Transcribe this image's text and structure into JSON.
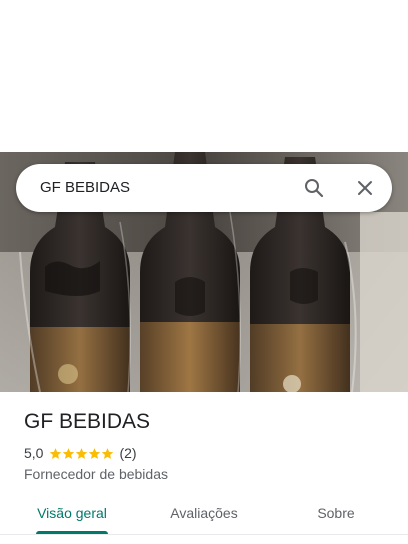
{
  "search": {
    "query": "GF BEBIDAS"
  },
  "place": {
    "name": "GF BEBIDAS",
    "rating": "5,0",
    "stars": 5,
    "review_count": "(2)",
    "category": "Fornecedor de bebidas"
  },
  "tabs": [
    {
      "label": "Visão geral",
      "selected": true
    },
    {
      "label": "Avaliações",
      "selected": false
    },
    {
      "label": "Sobre",
      "selected": false
    }
  ],
  "colors": {
    "accent": "#00796b",
    "star": "#fbbc04",
    "text_primary": "#202124",
    "text_secondary": "#5f6368"
  },
  "icons": {
    "search": "search-icon",
    "close": "close-icon",
    "star": "star-icon"
  }
}
